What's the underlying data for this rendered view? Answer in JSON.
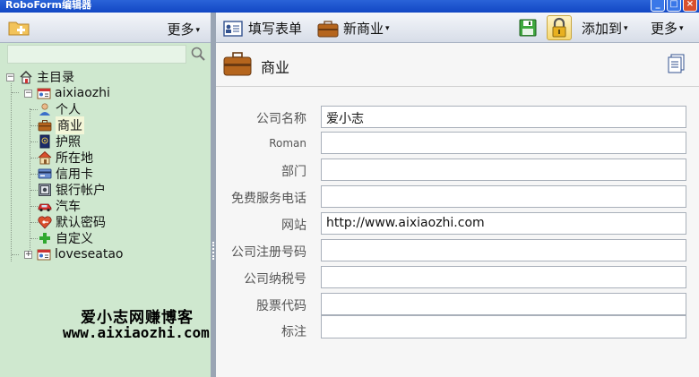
{
  "window": {
    "title": "RoboForm编辑器"
  },
  "left_toolbar": {
    "more_label": "更多"
  },
  "search": {
    "placeholder": "",
    "value": ""
  },
  "tree": {
    "root_label": "主目录",
    "profiles": [
      {
        "label": "aixiaozhi",
        "expanded": true,
        "children": [
          {
            "label": "个人",
            "icon": "person-icon"
          },
          {
            "label": "商业",
            "icon": "briefcase-icon",
            "selected": true
          },
          {
            "label": "护照",
            "icon": "passport-icon"
          },
          {
            "label": "所在地",
            "icon": "house-icon"
          },
          {
            "label": "信用卡",
            "icon": "credit-card-icon"
          },
          {
            "label": "银行帐户",
            "icon": "safe-icon"
          },
          {
            "label": "汽车",
            "icon": "car-icon"
          },
          {
            "label": "默认密码",
            "icon": "heart-key-icon"
          },
          {
            "label": "自定义",
            "icon": "plus-icon"
          }
        ]
      },
      {
        "label": "loveseatao",
        "expanded": false,
        "children": []
      }
    ]
  },
  "watermark": {
    "line1": "爱小志网赚博客",
    "line2": "www.aixiaozhi.com"
  },
  "right_toolbar": {
    "fill_form_label": "填写表单",
    "new_business_label": "新商业",
    "add_to_label": "添加到",
    "more_label": "更多"
  },
  "section": {
    "title": "商业"
  },
  "form": {
    "fields": [
      {
        "label": "公司名称",
        "value": "爱小志"
      },
      {
        "label": "Roman",
        "value": ""
      },
      {
        "label": "部门",
        "value": ""
      },
      {
        "label": "免费服务电话",
        "value": ""
      },
      {
        "label": "网站",
        "value": "http://www.aixiaozhi.com"
      },
      {
        "label": "公司注册号码",
        "value": ""
      },
      {
        "label": "公司纳税号",
        "value": ""
      },
      {
        "label": "股票代码",
        "value": ""
      },
      {
        "label": "标注",
        "value": ""
      }
    ]
  },
  "colors": {
    "left_bg": "#cfe8cf",
    "toolbar_bg": "#e3e8f0",
    "accent": "#1247c4"
  }
}
